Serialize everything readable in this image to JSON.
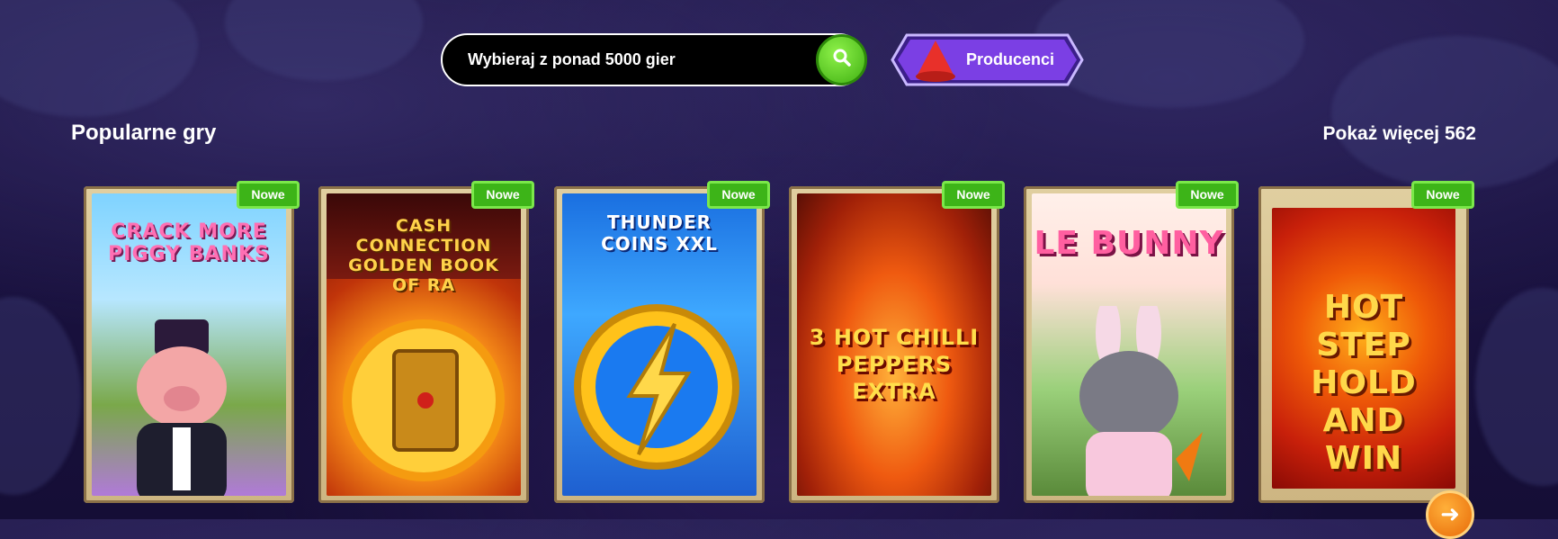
{
  "search": {
    "placeholder": "Wybieraj z ponad 5000 gier",
    "icon": "search-icon"
  },
  "providers": {
    "label": "Producenci",
    "icon": "cone-icon"
  },
  "section": {
    "title": "Popularne gry",
    "show_more": "Pokaż więcej 562"
  },
  "games": [
    {
      "title": "CRACK MORE PIGGY BANKS",
      "badge": "Nowe"
    },
    {
      "title": "CASH CONNECTION GOLDEN BOOK OF RA",
      "badge": "Nowe"
    },
    {
      "title": "THUNDER COINS XXL",
      "badge": "Nowe"
    },
    {
      "title": "3 HOT CHILLI PEPPERS EXTRA",
      "badge": "Nowe"
    },
    {
      "title": "LE BUNNY",
      "badge": "Nowe"
    },
    {
      "title": "HOT STEP HOLD AND WIN",
      "badge": "Nowe"
    }
  ],
  "next": {
    "icon": "arrow-right-icon"
  },
  "colors": {
    "accent_green": "#3db418",
    "accent_purple": "#7b3fe4",
    "accent_orange": "#f07a12"
  }
}
